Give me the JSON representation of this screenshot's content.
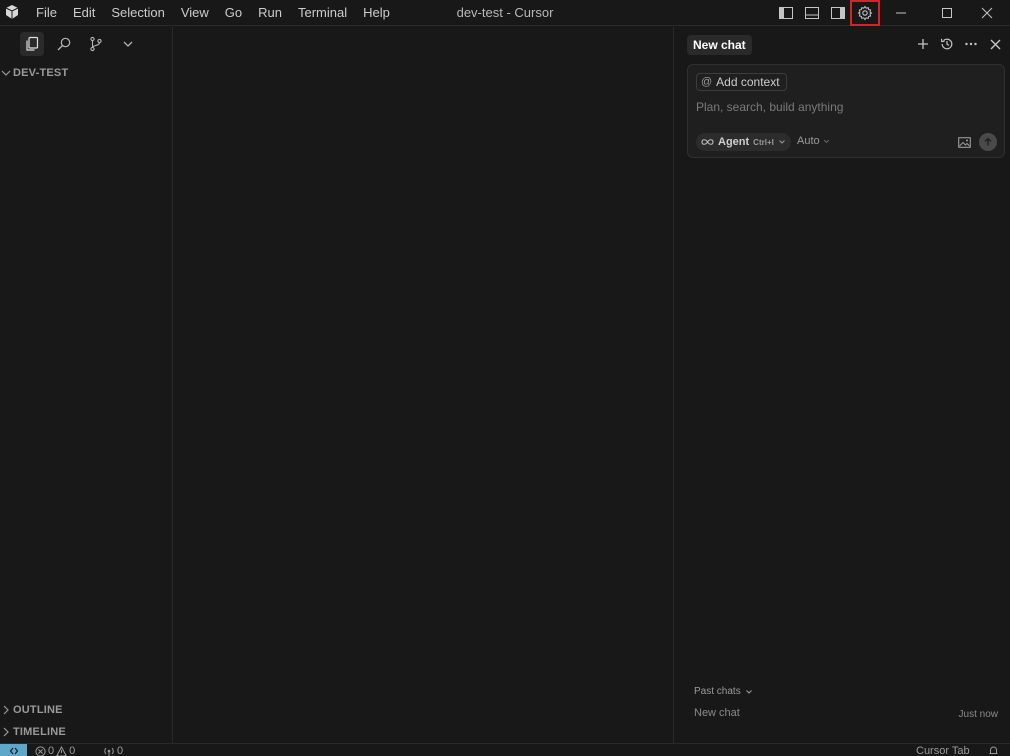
{
  "titlebar": {
    "menu": [
      "File",
      "Edit",
      "Selection",
      "View",
      "Go",
      "Run",
      "Terminal",
      "Help"
    ],
    "window_title": "dev-test - Cursor"
  },
  "sidebar": {
    "folder": "DEV-TEST",
    "outline": "OUTLINE",
    "timeline": "TIMELINE"
  },
  "chat": {
    "tab_title": "New chat",
    "add_context_label": "Add context",
    "placeholder": "Plan, search, build anything",
    "agent_label": "Agent",
    "agent_shortcut": "Ctrl+I",
    "model_label": "Auto",
    "past_chats_label": "Past chats",
    "past_chats": [
      {
        "title": "New chat",
        "time": "Just now"
      }
    ]
  },
  "statusbar": {
    "errors": "0",
    "warnings": "0",
    "ports": "0",
    "cursor_tab": "Cursor Tab"
  },
  "colors": {
    "background": "#181818",
    "highlight": "#e02020",
    "remote_accent": "#5fa7c9"
  }
}
